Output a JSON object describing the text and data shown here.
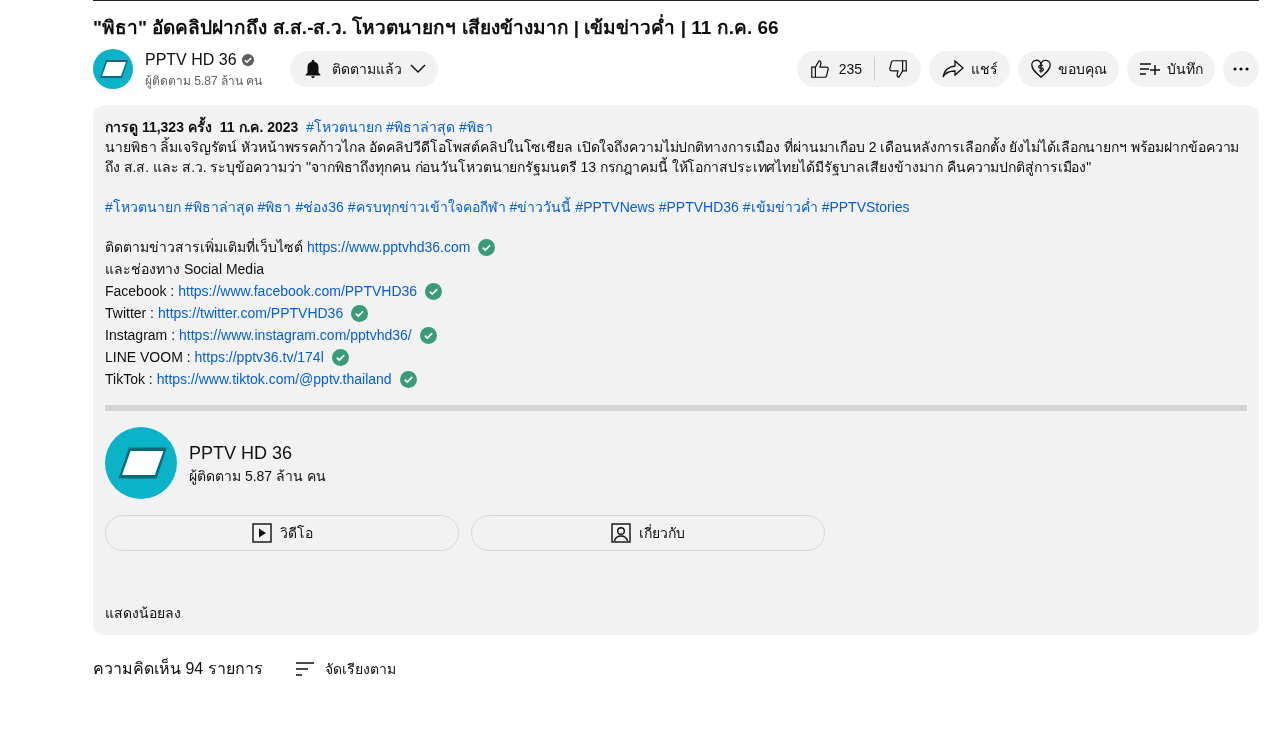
{
  "video": {
    "title": "\"พิธา\" อัดคลิปฝากถึง ส.ส.-ส.ว. โหวตนายกฯ เสียงข้างมาก | เข้มข่าวค่ำ | 11 ก.ค. 66"
  },
  "channel": {
    "name": "PPTV HD 36",
    "verified": true,
    "subscribers": "ผู้ติดตาม 5.87 ล้าน คน",
    "subscribe_button": {
      "label": "ติดตามแล้ว",
      "subscribed": true
    }
  },
  "actions": {
    "likes": "235",
    "share": "แชร์",
    "thanks": "ขอบคุณ",
    "save": "บันทึก"
  },
  "description": {
    "views": "การดู 11,323 ครั้ง",
    "date": "11 ก.ค. 2023",
    "top_hashtags": [
      "#โหวตนายก",
      "#พิธาล่าสุด",
      "#พิธา"
    ],
    "paragraph": "นายพิธา  ลิ้มเจริญรัตน์  หัวหน้าพรรคก้าวไกล  อัดคลิปวีดีโอโพสต์คลิปในโซเชียล  เปิดใจถึงความไม่ปกติทางการเมือง ที่ผ่านมาเกือบ 2  เดือนหลังการเลือกตั้ง ยังไม่ได้เลือกนายกฯ พร้อมฝากข้อความถึง ส.ส. และ  ส.ว. ระบุข้อความว่า  \"จากพิธาถึงทุกคน  ก่อนวันโหวตนายกรัฐมนตรี 13 กรกฎาคมนี้  ให้โอกาสประเทศไทยได้มีรัฐบาลเสียงข้างมาก คืนความปกติสู่การเมือง\"",
    "hashtags": [
      "#โหวตนายก",
      "#พิธาล่าสุด",
      "#พิธา",
      "#ช่อง36",
      "#ครบทุกข่าวเข้าใจคอกีฬา",
      "#ข่าววันนี้",
      "#PPTVNews",
      "#PPTVHD36",
      "#เข้มข่าวค่ำ",
      "#PPTVStories"
    ],
    "website": {
      "label": "ติดตามข่าวสารเพิ่มเติมที่เว็บไซต์",
      "url": "https://www.pptvhd36.com"
    },
    "social_intro": "และช่องทาง Social Media",
    "links": [
      {
        "label": "Facebook :",
        "url": "https://www.facebook.com/PPTVHD36"
      },
      {
        "label": "Twitter :",
        "url": "https://twitter.com/PPTVHD36"
      },
      {
        "label": "Instagram :",
        "url": "https://www.instagram.com/pptvhd36/"
      },
      {
        "label": "LINE VOOM :",
        "url": "https://pptv36.tv/174l"
      },
      {
        "label": "TikTok :",
        "url": "https://www.tiktok.com/@pptv.thailand"
      }
    ],
    "channel_card": {
      "name": "PPTV HD 36",
      "subscribers": "ผู้ติดตาม 5.87 ล้าน คน",
      "buttons": [
        {
          "kind": "videos",
          "label": "วิดีโอ"
        },
        {
          "kind": "about",
          "label": "เกี่ยวกับ"
        }
      ]
    },
    "show_less": "แสดงน้อยลง"
  },
  "comments": {
    "count": "ความคิดเห็น 94 รายการ",
    "sort": "จัดเรียงตาม"
  }
}
